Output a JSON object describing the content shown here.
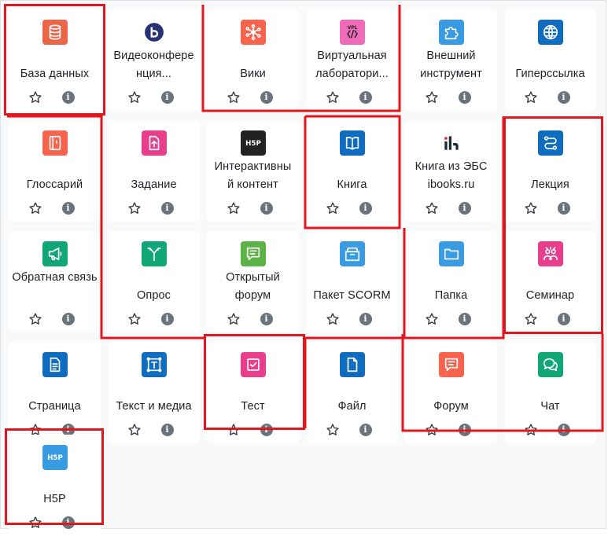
{
  "colors": {
    "admin": "#eb6649",
    "communication": "#0f6cbf",
    "collaboration": "#f7634d",
    "content": "#0f6cbf",
    "assessment": "#e83e8c",
    "interactive": "#399be2",
    "green": "#5bb246",
    "teal": "#11a676",
    "highlight": "#e3161e"
  },
  "activities": [
    {
      "name": "База данных",
      "icon": "database-icon"
    },
    {
      "name": "Видеоконфере нция...",
      "icon": "bigbluebutton-icon"
    },
    {
      "name": "Вики",
      "icon": "wiki-icon"
    },
    {
      "name": "Виртуальная лаборатори...",
      "icon": "vpl-icon"
    },
    {
      "name": "Внешний инструмент",
      "icon": "puzzle-icon"
    },
    {
      "name": "Гиперссылка",
      "icon": "globe-icon"
    },
    {
      "name": "Глоссарий",
      "icon": "glossary-book-icon"
    },
    {
      "name": "Задание",
      "icon": "assignment-upload-icon"
    },
    {
      "name": "Интерактивны й контент",
      "icon": "h5p-dark-icon"
    },
    {
      "name": "Книга",
      "icon": "open-book-icon"
    },
    {
      "name": "Книга из ЭБС ibooks.ru",
      "icon": "ibooks-logo-icon"
    },
    {
      "name": "Лекция",
      "icon": "lesson-path-icon"
    },
    {
      "name": "Обратная связь",
      "icon": "megaphone-icon"
    },
    {
      "name": "Опрос",
      "icon": "signpost-icon"
    },
    {
      "name": "Открытый форум",
      "icon": "speech-bubble-icon"
    },
    {
      "name": "Пакет SCORM",
      "icon": "package-box-icon"
    },
    {
      "name": "Папка",
      "icon": "folder-icon"
    },
    {
      "name": "Семинар",
      "icon": "workshop-people-icon"
    },
    {
      "name": "Страница",
      "icon": "page-document-icon"
    },
    {
      "name": "Текст и медиа",
      "icon": "text-frame-icon"
    },
    {
      "name": "Тест",
      "icon": "quiz-checkbox-icon"
    },
    {
      "name": "Файл",
      "icon": "file-icon"
    },
    {
      "name": "Форум",
      "icon": "forum-bubble-icon"
    },
    {
      "name": "Чат",
      "icon": "chat-bubbles-icon"
    },
    {
      "name": "H5P",
      "icon": "h5p-blue-icon"
    }
  ]
}
